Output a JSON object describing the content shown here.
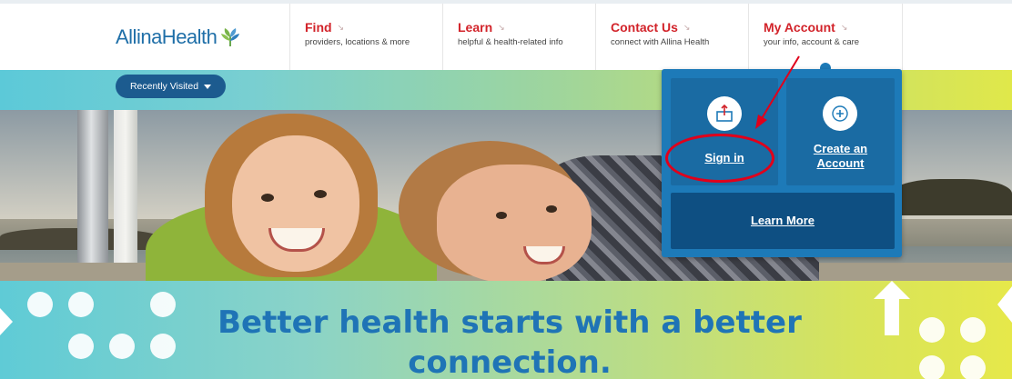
{
  "logo": {
    "text": "AllinaHealth",
    "icon": "leaf-logo-icon"
  },
  "nav": [
    {
      "title": "Find",
      "subtitle": "providers, locations & more"
    },
    {
      "title": "Learn",
      "subtitle": "helpful & health-related info"
    },
    {
      "title": "Contact Us",
      "subtitle": "connect with Allina Health"
    },
    {
      "title": "My Account",
      "subtitle": "your info, account & care"
    }
  ],
  "recently_visited": {
    "label": "Recently Visited"
  },
  "account_menu": {
    "sign_in": "Sign in",
    "create_line1": "Create an",
    "create_line2": "Account",
    "learn_more": "Learn More"
  },
  "banner": {
    "line1": "Better health starts with a better",
    "line2": "connection."
  },
  "colors": {
    "brand_blue": "#1f74b6",
    "nav_red": "#d2232a",
    "dropdown_blue": "#1d7ab8",
    "annotation_red": "#e0001b"
  }
}
